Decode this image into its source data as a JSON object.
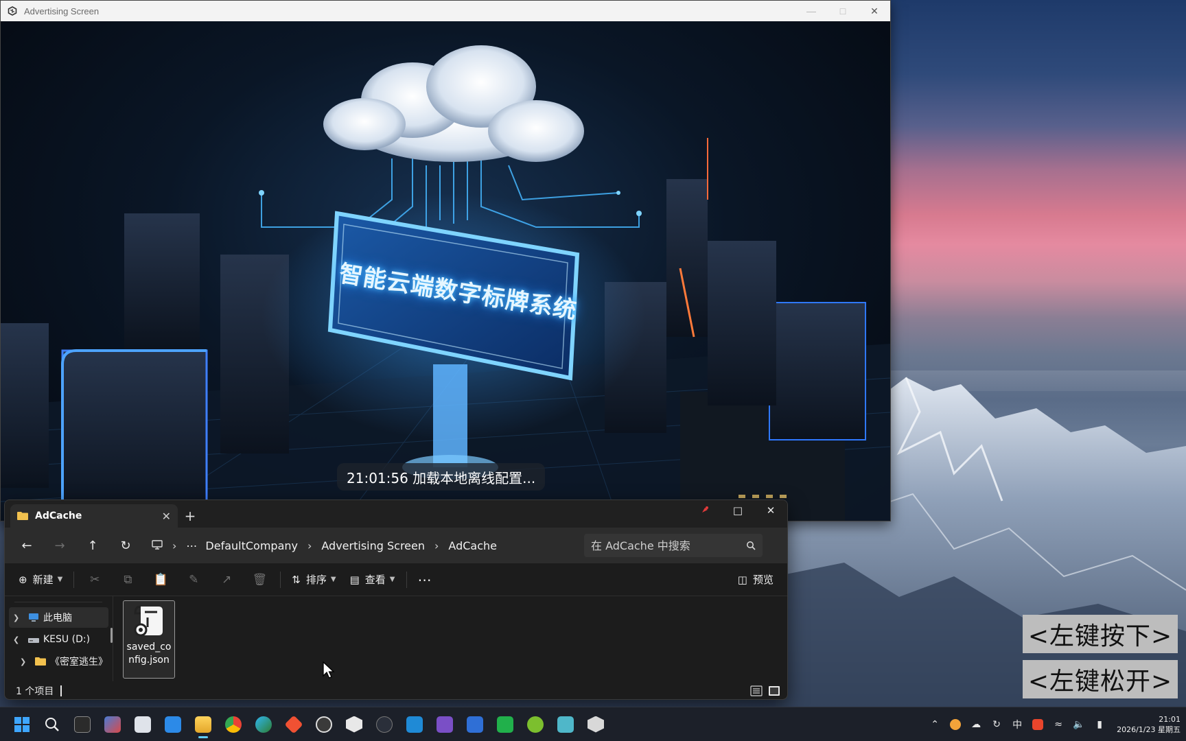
{
  "ad_window": {
    "title": "Advertising Screen",
    "billboard_text": "智能云端数字标牌系统",
    "status_message": "21:01:56 加载本地离线配置..."
  },
  "explorer": {
    "tab_title": "AdCache",
    "address": {
      "segments": [
        "DefaultCompany",
        "Advertising Screen",
        "AdCache"
      ]
    },
    "search": {
      "placeholder": "在 AdCache 中搜索"
    },
    "toolbar": {
      "new_label": "新建",
      "sort_label": "排序",
      "view_label": "查看",
      "preview_label": "预览"
    },
    "nav_tree": [
      {
        "label": "此电脑",
        "icon": "computer-icon",
        "expanded": false
      },
      {
        "label": "KESU (D:)",
        "icon": "drive-icon",
        "expanded": true
      },
      {
        "label": "《密室逃生》",
        "icon": "folder-icon",
        "expanded": false
      }
    ],
    "files": [
      {
        "name": "saved_config.json",
        "icon": "json-file-icon"
      }
    ],
    "status_text": "1 个项目"
  },
  "key_overlays": {
    "down": "<左键按下>",
    "up": "<左键松开>"
  },
  "taskbar": {
    "apps": [
      "start-icon",
      "search-icon",
      "terminal-icon",
      "tasks-icon",
      "widgets-icon",
      "store-icon",
      "file-explorer-icon",
      "chrome-icon",
      "edge-icon",
      "git-icon",
      "unity-hub-icon",
      "unity-icon",
      "steam-icon",
      "vscode-icon",
      "visual-studio-icon",
      "app-star-icon",
      "wechat-icon",
      "app-green-icon",
      "notepad-icon",
      "unity-player-icon"
    ],
    "active_app": "file-explorer-icon",
    "tray": {
      "ime": "中",
      "time": "21:01",
      "date": "2026/1/23 星期五"
    }
  },
  "colors": {
    "accent": "#60cdff",
    "billboard_glow": "#4fc3ff"
  }
}
